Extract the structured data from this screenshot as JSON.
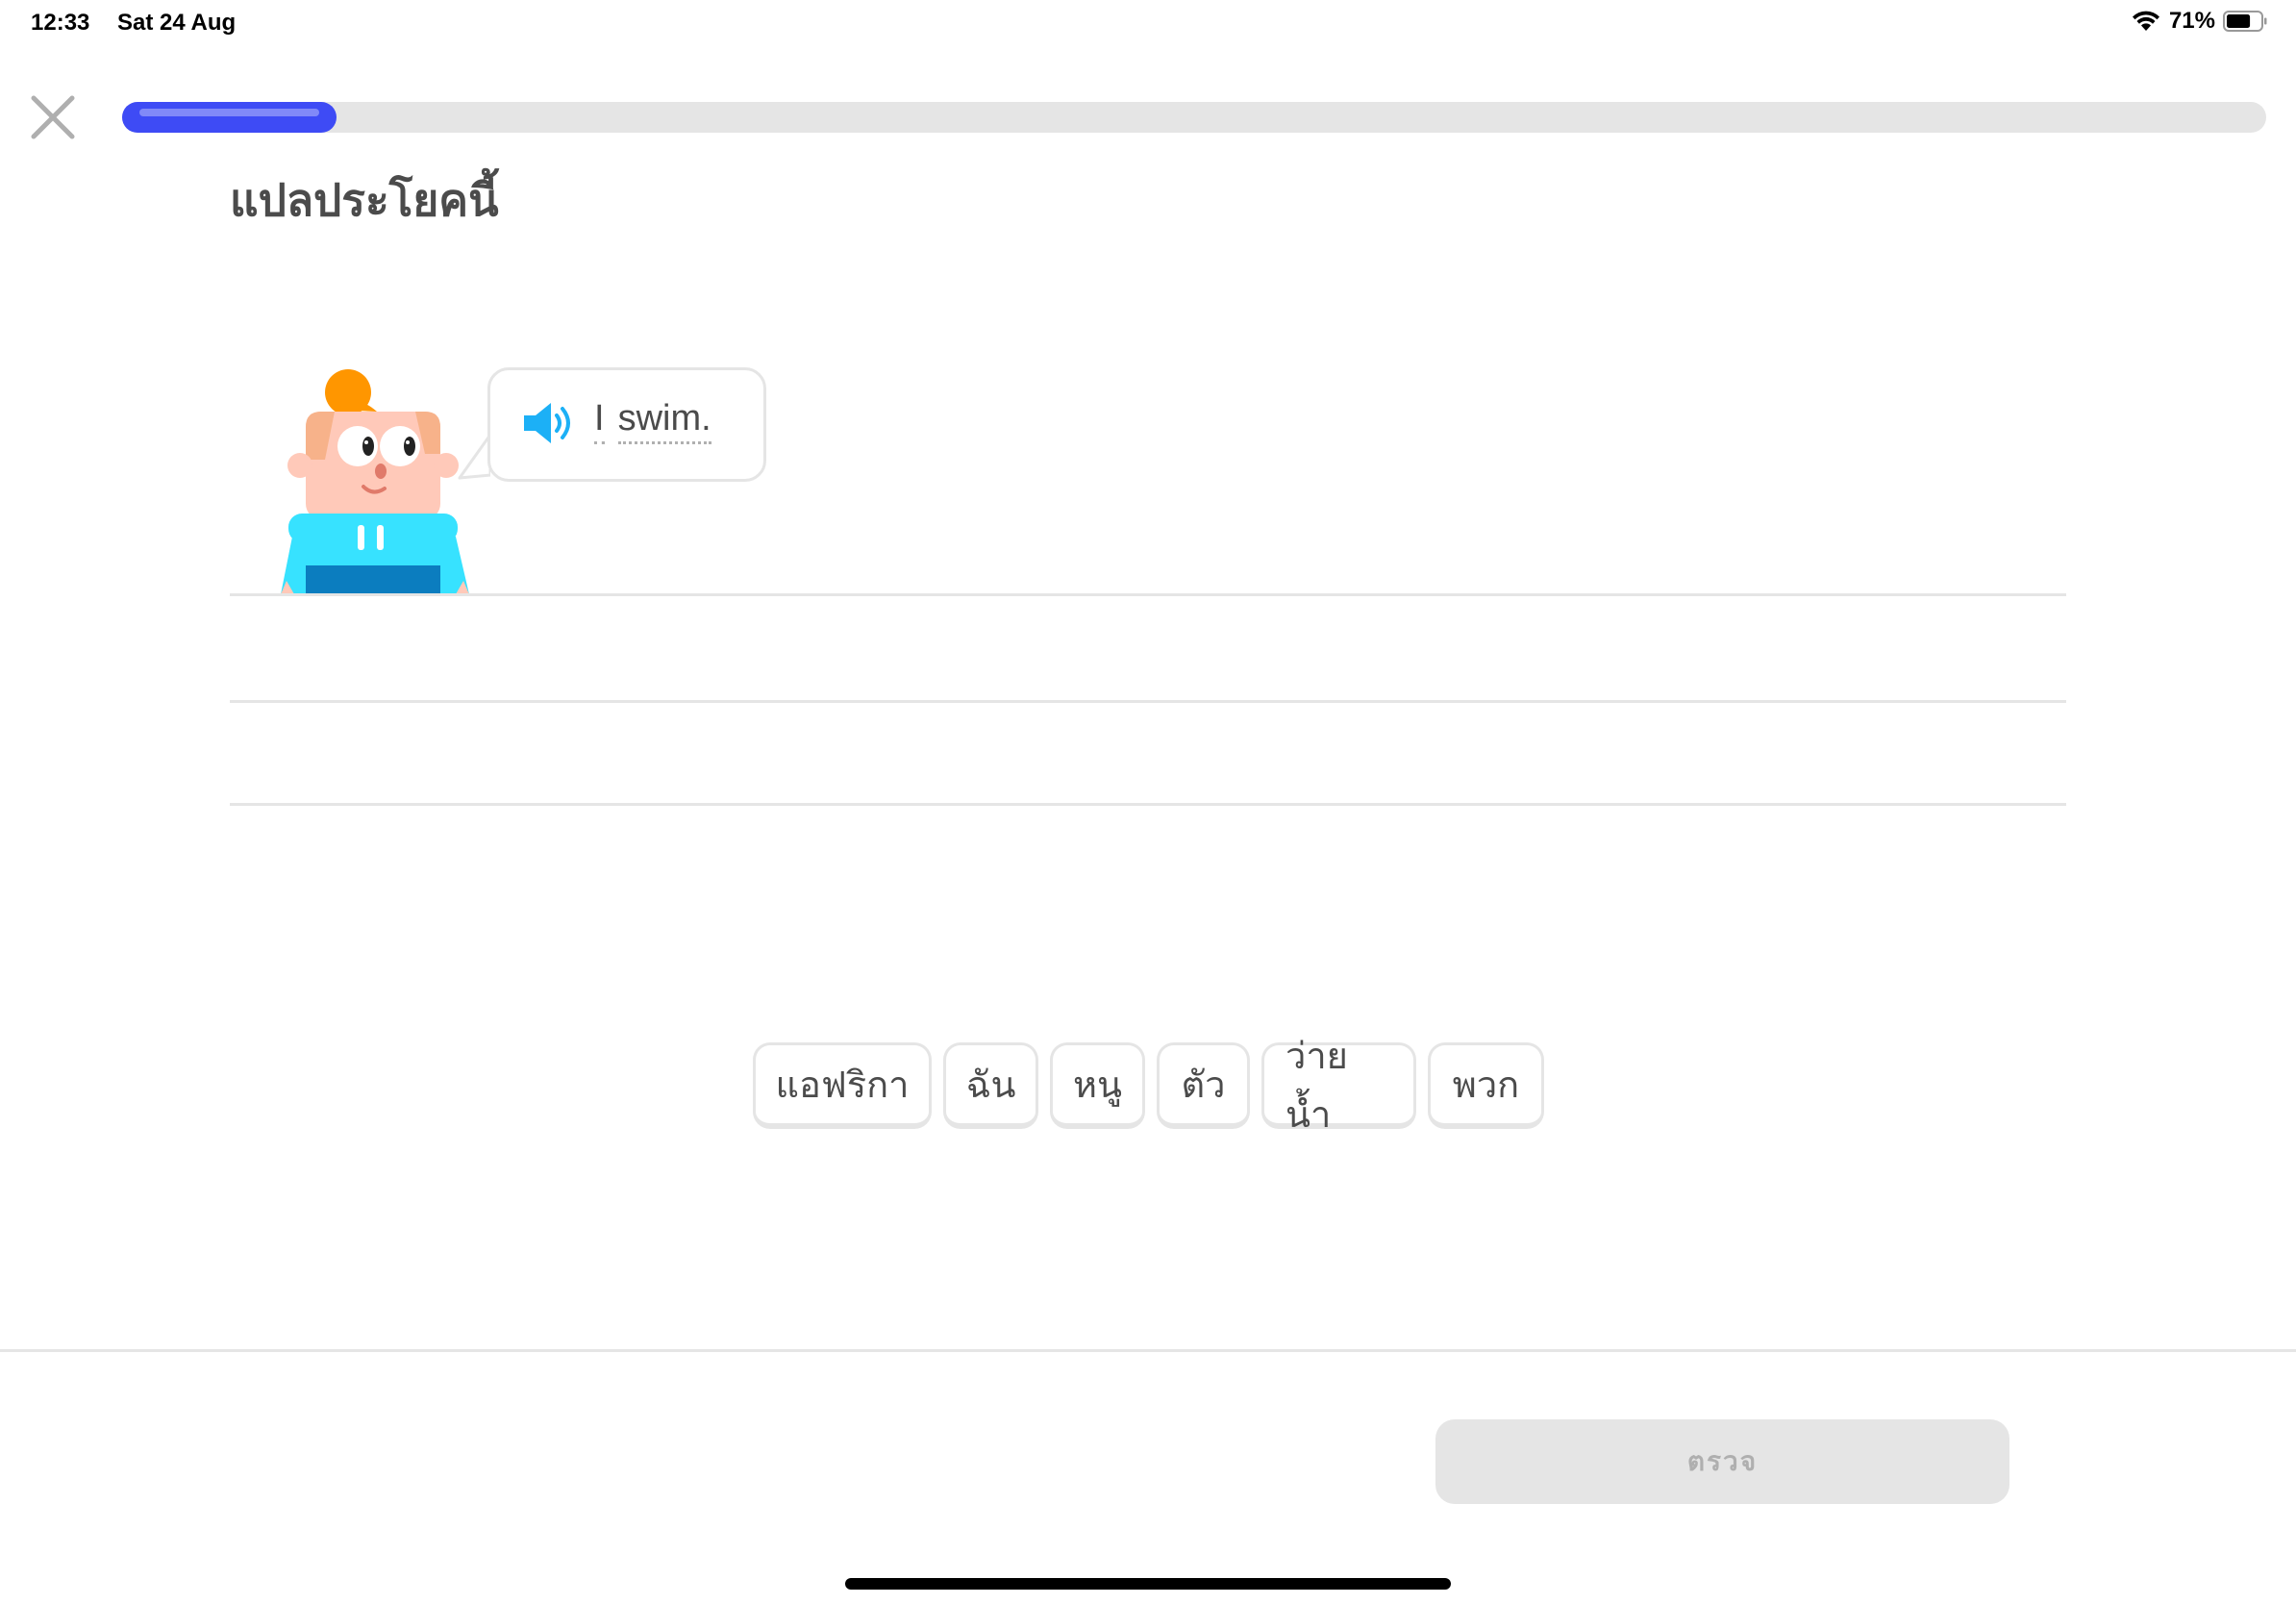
{
  "status_bar": {
    "time": "12:33",
    "date": "Sat 24 Aug",
    "battery_percent": "71%",
    "battery_level": 0.71,
    "icons": [
      "wifi-icon",
      "battery-icon"
    ]
  },
  "lesson": {
    "progress": 0.1,
    "close_icon": "close-icon",
    "prompt_title": "แปลประโยคนี้"
  },
  "speech": {
    "speaker_icon": "speaker-icon",
    "words": [
      "I",
      "swim."
    ]
  },
  "word_bank": [
    "แอฟริกา",
    "ฉัน",
    "หนู",
    "ตัว",
    "ว่ายน้ำ",
    "พวก"
  ],
  "footer": {
    "check_label": "ตรวจ"
  },
  "colors": {
    "progress_fill": "#3e4bf5",
    "speaker": "#1cb0f6",
    "disabled_button": "#e5e5e5",
    "disabled_text": "#afafaf",
    "border": "#e5e5e5"
  }
}
